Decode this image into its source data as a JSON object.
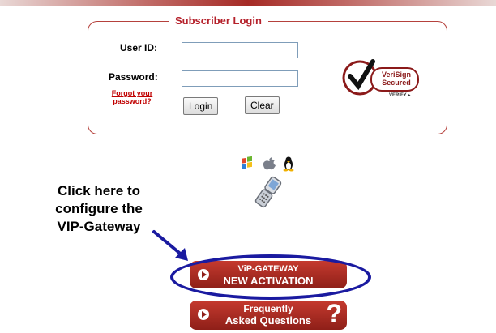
{
  "login": {
    "title": "Subscriber Login",
    "userid_label": "User ID:",
    "password_label": "Password:",
    "userid_value": "",
    "password_value": "",
    "forgot_line1": "Forgot your",
    "forgot_line2": "password?",
    "login_button": "Login",
    "clear_button": "Clear"
  },
  "verisign": {
    "line1": "VeriSign",
    "line2": "Secured",
    "verify": "VERIFY ▸"
  },
  "callout": {
    "line1": "Click here to",
    "line2": "configure the",
    "line3": "VIP-Gateway"
  },
  "vip_button": {
    "line1": "ViP-GATEWAY",
    "line2": "NEW ACTIVATION"
  },
  "faq_button": {
    "line1": "Frequently",
    "line2": "Asked Questions",
    "icon": "?"
  },
  "colors": {
    "accent_red": "#b5212b",
    "button_red": "#a52a25",
    "highlight_blue": "#1a1aa0"
  }
}
